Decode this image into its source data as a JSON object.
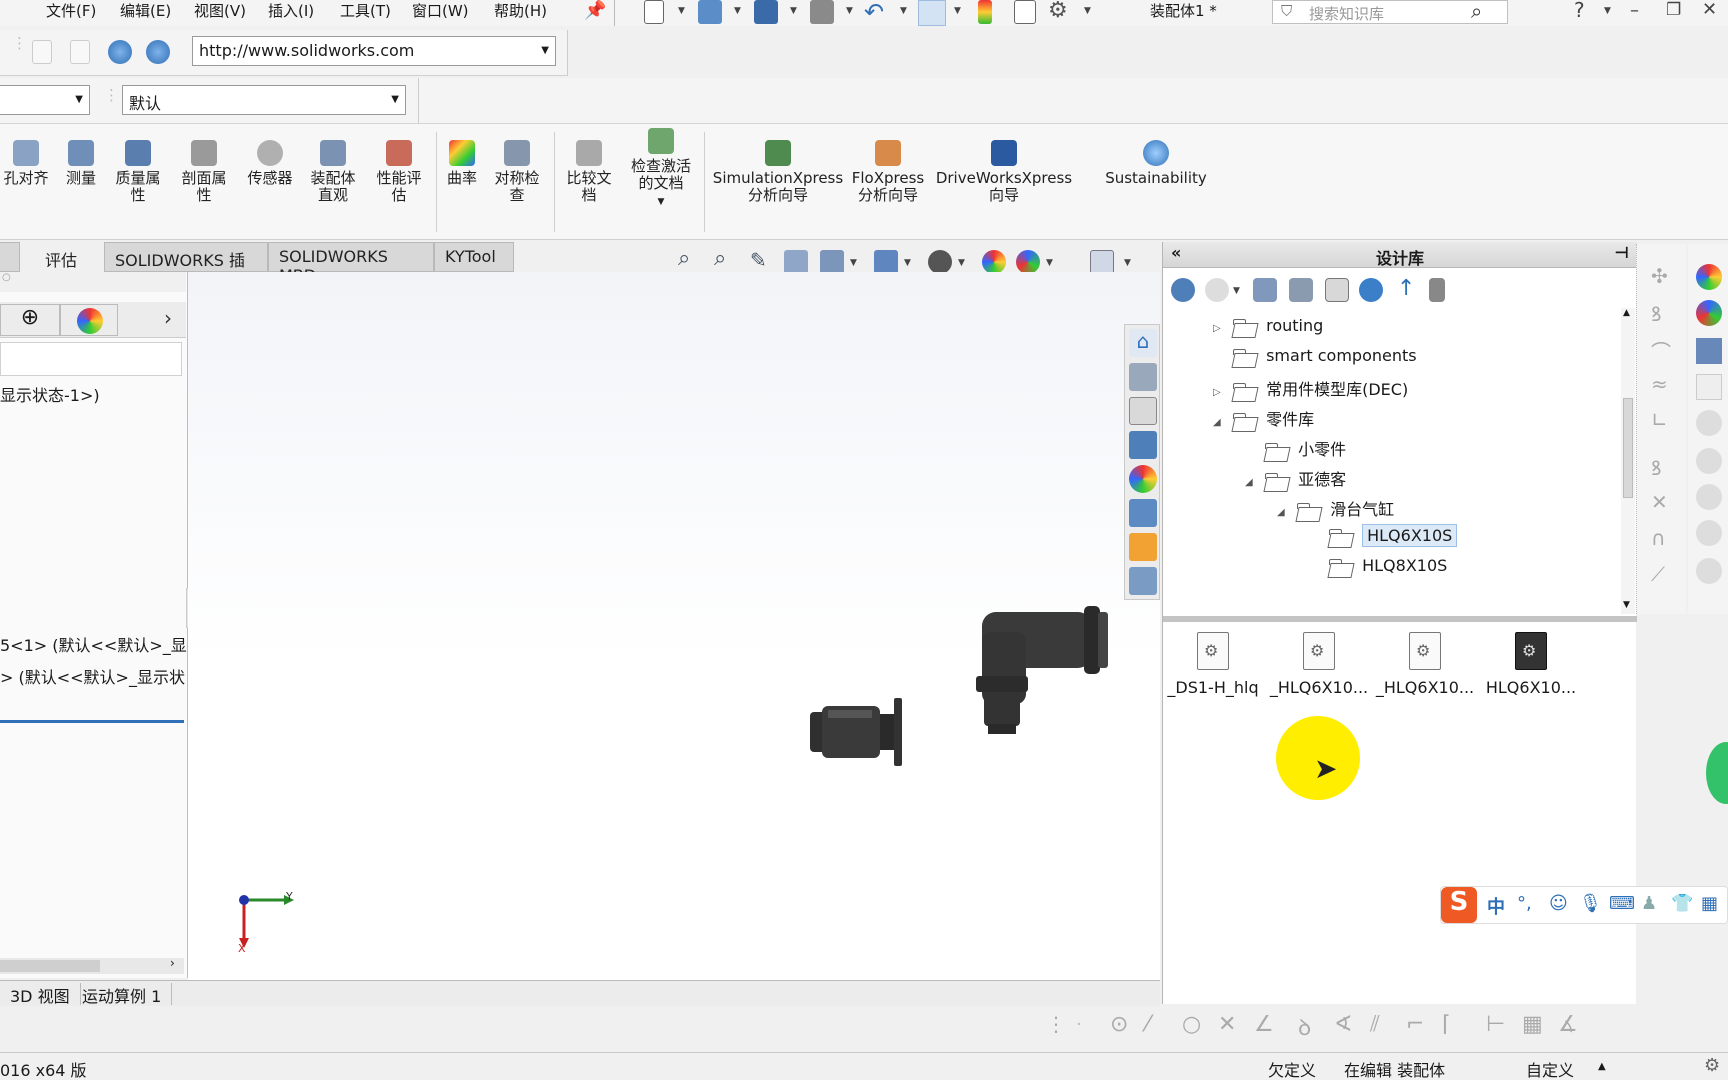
{
  "menubar": {
    "items": [
      "文件(F)",
      "编辑(E)",
      "视图(V)",
      "插入(I)",
      "工具(T)",
      "窗口(W)",
      "帮助(H)"
    ],
    "doc_title": "装配体1 *",
    "search_placeholder": "搜索知识库"
  },
  "url_bar": {
    "url": "http://www.solidworks.com"
  },
  "config_bar": {
    "display_state": "默认"
  },
  "command_bar": {
    "items": [
      {
        "label": "孔对齐",
        "icon": "hole-align-icon"
      },
      {
        "label": "测量",
        "icon": "measure-icon"
      },
      {
        "label": "质量属\n性",
        "icon": "mass-properties-icon"
      },
      {
        "label": "剖面属\n性",
        "icon": "section-properties-icon"
      },
      {
        "label": "传感器",
        "icon": "sensor-icon"
      },
      {
        "label": "装配体\n直观",
        "icon": "assembly-visualization-icon"
      },
      {
        "label": "性能评\n估",
        "icon": "performance-evaluation-icon"
      },
      {
        "label": "曲率",
        "icon": "curvature-icon"
      },
      {
        "label": "对称检\n查",
        "icon": "symmetry-check-icon"
      },
      {
        "label": "比较文\n档",
        "icon": "compare-documents-icon"
      },
      {
        "label": "检查激活\n的文档",
        "icon": "check-active-document-icon"
      },
      {
        "label": "SimulationXpress\n分析向导",
        "icon": "simulationxpress-icon"
      },
      {
        "label": "FloXpress\n分析向导",
        "icon": "floxpress-icon"
      },
      {
        "label": "DriveWorksXpress\n向导",
        "icon": "driveworksxpress-icon"
      },
      {
        "label": "Sustainability",
        "icon": "sustainability-icon"
      }
    ]
  },
  "tabs": [
    "评估",
    "SOLIDWORKS 插件",
    "SOLIDWORKS MBD",
    "KYTool"
  ],
  "left_panel": {
    "display_state_text": "显示状态-1>)",
    "row1": "5<1> (默认<<默认>_显",
    "row2": "> (默认<<默认>_显示状"
  },
  "design_library": {
    "title": "设计库",
    "tree": [
      {
        "label": "routing",
        "expander": "▷"
      },
      {
        "label": "smart components",
        "expander": ""
      },
      {
        "label": "常用件模型库(DEC)",
        "expander": "▷"
      },
      {
        "label": "零件库",
        "expander": "◢"
      },
      {
        "label": "小零件",
        "expander": ""
      },
      {
        "label": "亚德客",
        "expander": "◢"
      },
      {
        "label": "滑台气缸",
        "expander": "◢"
      },
      {
        "label": "HLQ6X10S",
        "expander": ""
      },
      {
        "label": "HLQ8X10S",
        "expander": ""
      }
    ],
    "files": [
      "_DS1-H_hlq",
      "_HLQ6X10...",
      "_HLQ6X10...",
      "HLQ6X10..."
    ]
  },
  "bottom_tabs": [
    "3D 视图",
    "运动算例 1"
  ],
  "status": {
    "version": "016 x64 版",
    "underdefined": "欠定义",
    "editing": "在编辑 装配体",
    "custom": "自定义"
  },
  "ime": {
    "lang": "中"
  },
  "axis": {
    "y": "Y",
    "x": "X"
  },
  "colors": {
    "accent": "#2f6fb7",
    "highlight": "#ffee00",
    "fitting": "#3a3a3a"
  }
}
